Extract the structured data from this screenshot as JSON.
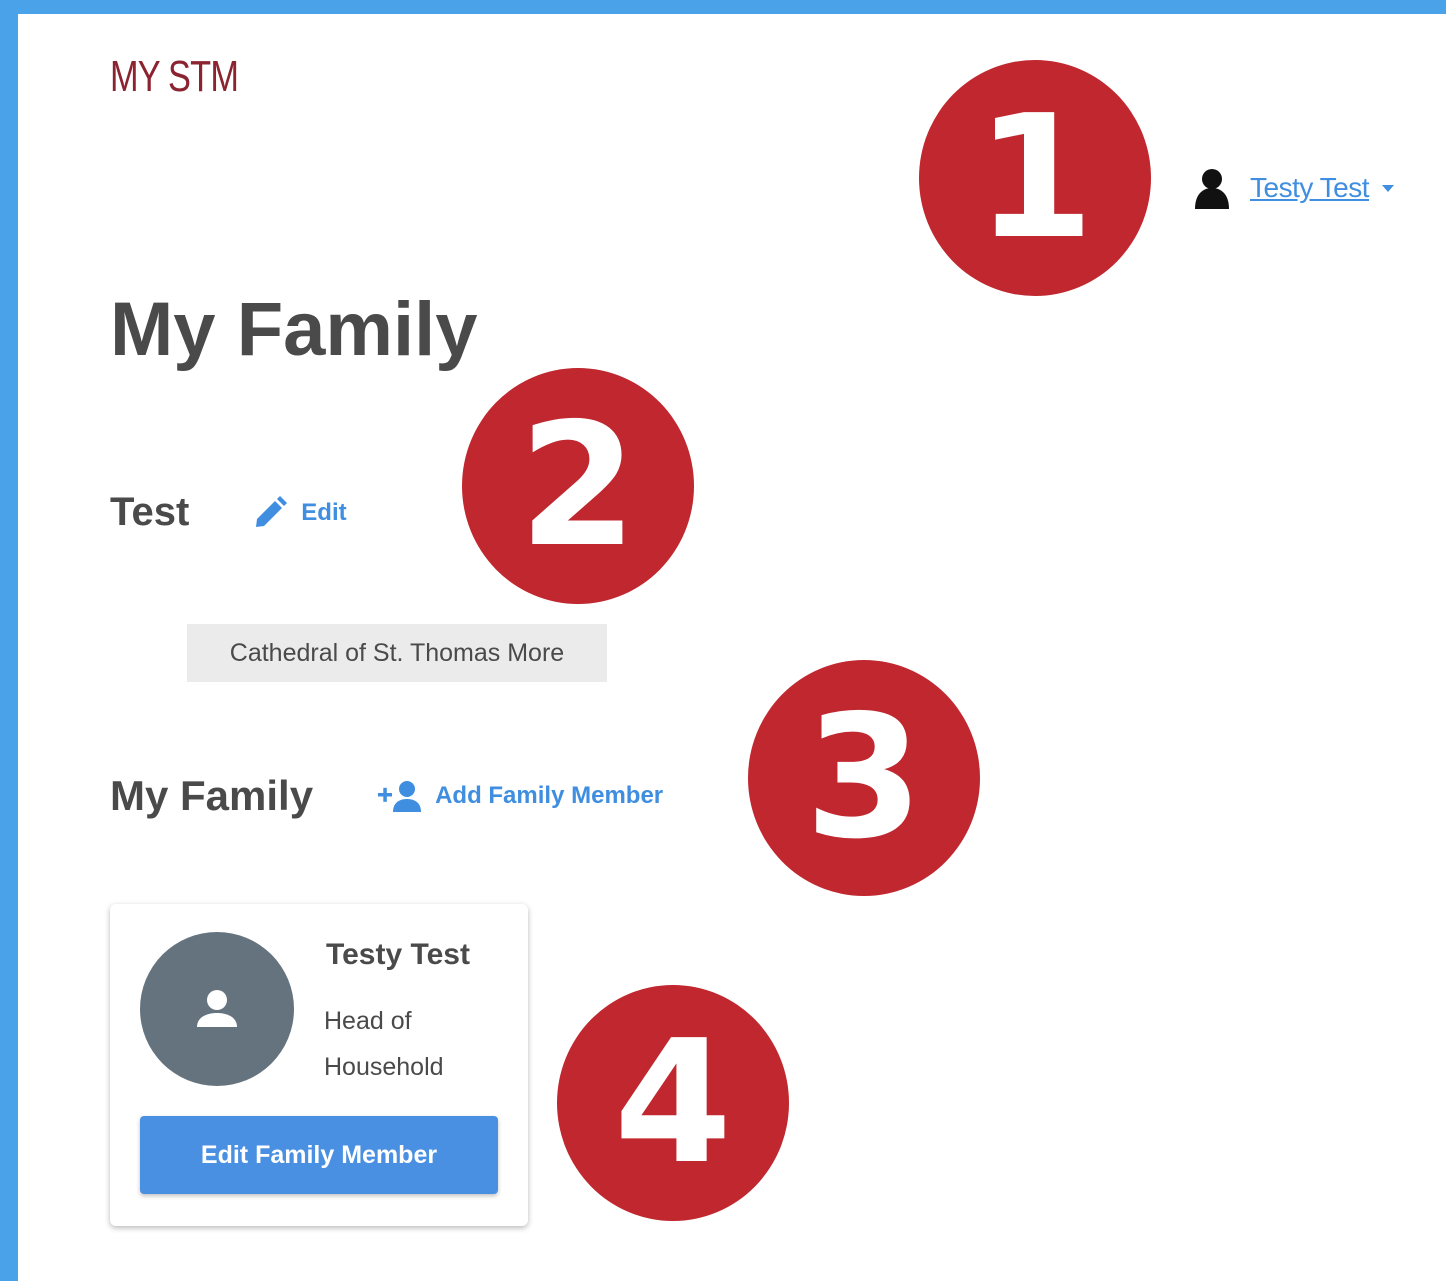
{
  "header": {
    "logo_text": "MY STM",
    "user_name": "Testy Test",
    "user_icon": "person-icon"
  },
  "page": {
    "title": "My Family"
  },
  "organization": {
    "name": "Test",
    "edit_label": "Edit",
    "parish": "Cathedral of St. Thomas More"
  },
  "family": {
    "heading": "My Family",
    "add_label": "Add Family Member",
    "members": [
      {
        "name": "Testy Test",
        "role": "Head of Household",
        "button_label": "Edit Family Member"
      }
    ]
  },
  "annotations": {
    "markers": [
      "1",
      "2",
      "3",
      "4"
    ]
  },
  "colors": {
    "frame": "#4aa3e8",
    "marker": "#c0272f",
    "link": "#3f8ee0",
    "logo": "#8b2330",
    "button": "#4a90e2",
    "avatar": "#65737e"
  }
}
